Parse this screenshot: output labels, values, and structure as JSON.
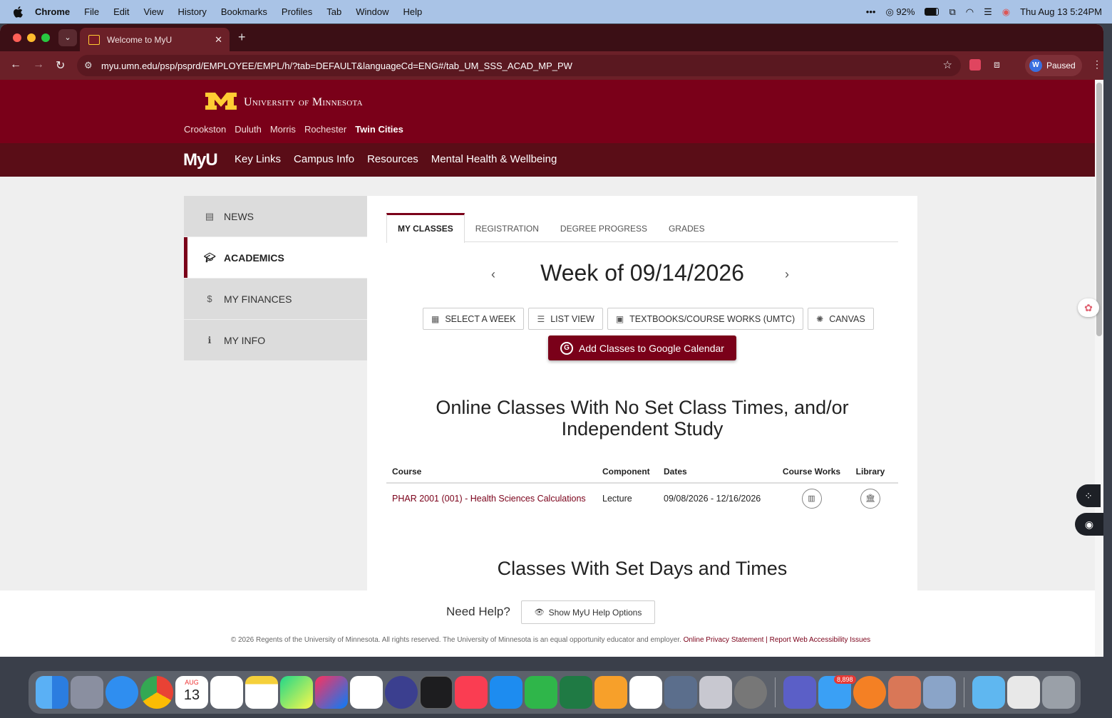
{
  "macos": {
    "app_name": "Chrome",
    "menus": [
      "File",
      "Edit",
      "View",
      "History",
      "Bookmarks",
      "Profiles",
      "Tab",
      "Window",
      "Help"
    ],
    "battery": "92%",
    "datetime": "Thu Aug 13  5:24PM"
  },
  "browser": {
    "tab_title": "Welcome to MyU",
    "url": "myu.umn.edu/psp/psprd/EMPLOYEE/EMPL/h/?tab=DEFAULT&languageCd=ENG#/tab_UM_SSS_ACAD_MP_PW",
    "profile_initial": "W",
    "profile_status": "Paused"
  },
  "header": {
    "university_name": "University of Minnesota",
    "campuses": [
      "Crookston",
      "Duluth",
      "Morris",
      "Rochester",
      "Twin Cities"
    ],
    "myu_logo": "MyU",
    "nav_links": [
      "Key Links",
      "Campus Info",
      "Resources",
      "Mental Health & Wellbeing"
    ]
  },
  "sidebar": {
    "items": [
      {
        "label": "NEWS",
        "icon": "newspaper-icon"
      },
      {
        "label": "ACADEMICS",
        "icon": "graduation-cap-icon"
      },
      {
        "label": "MY FINANCES",
        "icon": "dollar-icon"
      },
      {
        "label": "MY INFO",
        "icon": "info-icon"
      }
    ]
  },
  "main": {
    "tabs": [
      "MY CLASSES",
      "REGISTRATION",
      "DEGREE PROGRESS",
      "GRADES"
    ],
    "week_title": "Week of 09/14/2026",
    "buttons": {
      "select_week": "SELECT A WEEK",
      "list_view": "LIST VIEW",
      "textbooks": "TEXTBOOKS/COURSE WORKS (UMTC)",
      "canvas": "CANVAS",
      "google_calendar": "Add Classes to Google Calendar"
    },
    "online_heading": "Online Classes With No Set Class Times, and/or Independent Study",
    "table": {
      "headers": [
        "Course",
        "Component",
        "Dates",
        "Course Works",
        "Library"
      ],
      "rows": [
        {
          "course": "PHAR 2001 (001) - Health Sciences Calculations",
          "component": "Lecture",
          "dates": "09/08/2026 - 12/16/2026"
        }
      ]
    },
    "set_days_heading": "Classes With Set Days and Times"
  },
  "footer": {
    "need_help": "Need Help?",
    "help_button": "Show MyU Help Options",
    "copyright": "© 2026 Regents of the University of Minnesota. All rights reserved. The University of Minnesota is an equal opportunity educator and employer.",
    "privacy_link": "Online Privacy Statement",
    "separator": "|",
    "accessibility_link": "Report Web Accessibility Issues"
  },
  "dock": {
    "calendar_month": "AUG",
    "calendar_day": "13",
    "mail_badge": "8,898"
  },
  "colors": {
    "maroon": "#7a0019",
    "gold": "#ffcc33"
  }
}
